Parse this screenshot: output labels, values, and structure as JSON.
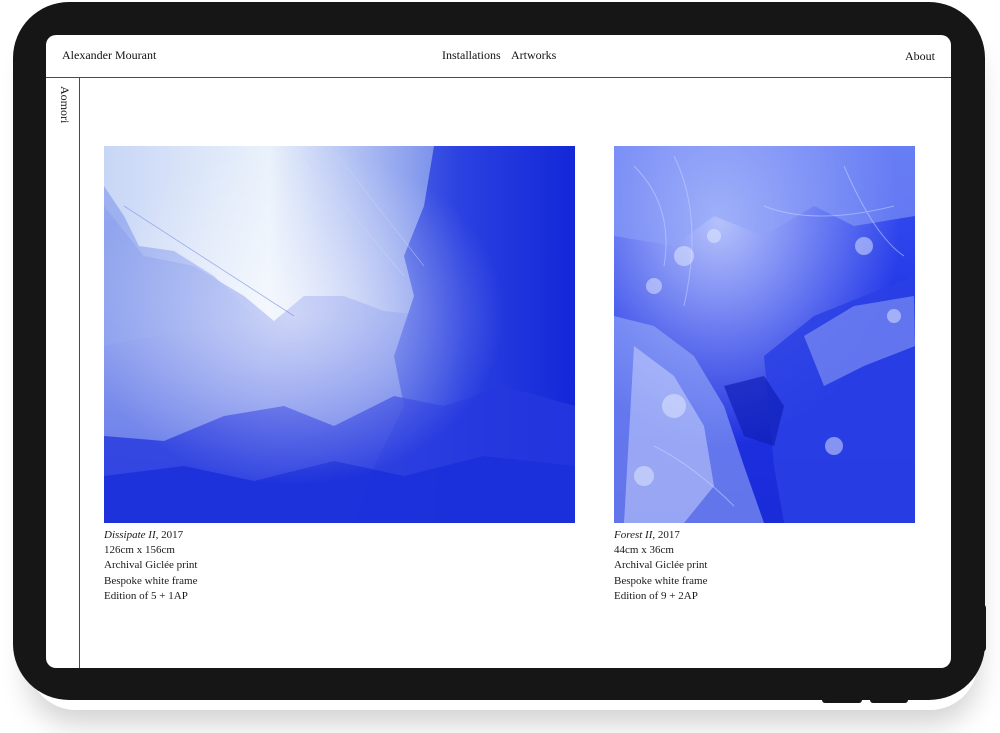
{
  "header": {
    "site_name": "Alexander Mourant",
    "nav": [
      {
        "label": "Installations"
      },
      {
        "label": "Artworks"
      }
    ],
    "about_label": "About"
  },
  "side_rail": {
    "label": "Aomori"
  },
  "artworks": [
    {
      "title": "Dissipate II",
      "year": ", 2017",
      "dimensions": "126cm x 156cm",
      "medium": "Archival Giclée print",
      "frame": "Bespoke white frame",
      "edition": "Edition of 5 + 1AP"
    },
    {
      "title": "Forest II",
      "year": ", 2017",
      "dimensions": "44cm x 36cm",
      "medium": "Archival Giclée print",
      "frame": "Bespoke white frame",
      "edition": "Edition of 9 + 2AP"
    }
  ],
  "colors": {
    "device_frame": "#161616",
    "rule_line": "#4a4a4a",
    "photo_blue": "#1c2fe0",
    "photo_haze": "#eaf2fb"
  }
}
